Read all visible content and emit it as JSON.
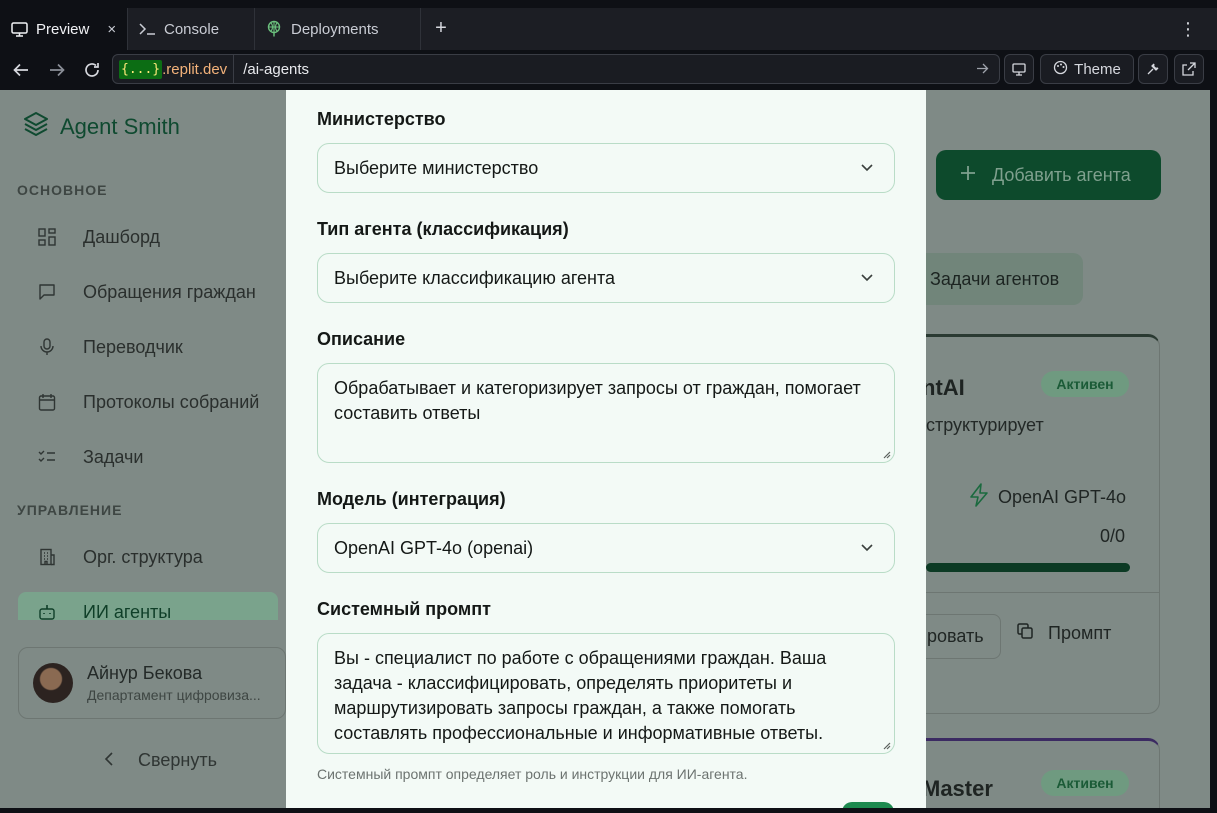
{
  "browser": {
    "tabs": [
      {
        "label": "Preview",
        "icon": "monitor-icon",
        "active": true
      },
      {
        "label": "Console",
        "icon": "terminal-icon",
        "active": false
      },
      {
        "label": "Deployments",
        "icon": "deploy-icon",
        "active": false
      }
    ],
    "close_glyph": "×",
    "new_tab_glyph": "+",
    "menu_glyph": "⋮",
    "url": {
      "badge": "{...}",
      "domain": ".replit.dev",
      "path": "/ai-agents"
    },
    "theme_label": "Theme"
  },
  "sidebar": {
    "app_name": "Agent Smith",
    "section_main": "ОСНОВНОЕ",
    "section_manage": "УПРАВЛЕНИЕ",
    "main_items": [
      {
        "label": "Дашборд",
        "icon": "grid-icon"
      },
      {
        "label": "Обращения граждан",
        "icon": "message-icon"
      },
      {
        "label": "Переводчик",
        "icon": "microphone-icon"
      },
      {
        "label": "Протоколы собраний",
        "icon": "calendar-icon"
      },
      {
        "label": "Задачи",
        "icon": "checklist-icon"
      }
    ],
    "manage_items": [
      {
        "label": "Орг. структура",
        "icon": "building-icon"
      },
      {
        "label": "ИИ агенты",
        "icon": "bot-icon",
        "active": true
      }
    ],
    "user": {
      "name": "Айнур Бекова",
      "dept": "Департамент цифровиза..."
    },
    "collapse_label": "Свернуть"
  },
  "main": {
    "add_agent_label": "Добавить агента",
    "tasks_tab_label": "Задачи агентов",
    "card1": {
      "title": "ntAI",
      "status": "Активен",
      "desc": "структурирует",
      "model": "OpenAI GPT-4o",
      "ratio": "0/0",
      "edit_label": "ровать",
      "prompt_label": "Промпт"
    },
    "card2": {
      "title": "Master",
      "status": "Активен"
    }
  },
  "modal": {
    "ministry": {
      "label": "Министерство",
      "value": "Выберите министерство"
    },
    "agent_type": {
      "label": "Тип агента (классификация)",
      "value": "Выберите классификацию агента"
    },
    "description": {
      "label": "Описание",
      "value": "Обрабатывает и категоризирует запросы от граждан, помогает составить ответы"
    },
    "model": {
      "label": "Модель (интеграция)",
      "value": "OpenAI GPT-4o (openai)"
    },
    "system_prompt": {
      "label": "Системный промпт",
      "value": "Вы - специалист по работе с обращениями граждан. Ваша задача - классифицировать, определять приоритеты и маршрутизировать запросы граждан, а также помогать составлять профессиональные и информативные ответы.",
      "hint": "Системный промпт определяет роль и инструкции для ИИ-агента."
    }
  },
  "colors": {
    "brand_green": "#0d4a2c",
    "modal_bg": "#f3faf6",
    "field_border": "#b9dcc7",
    "overlay": "#7f8a86"
  }
}
